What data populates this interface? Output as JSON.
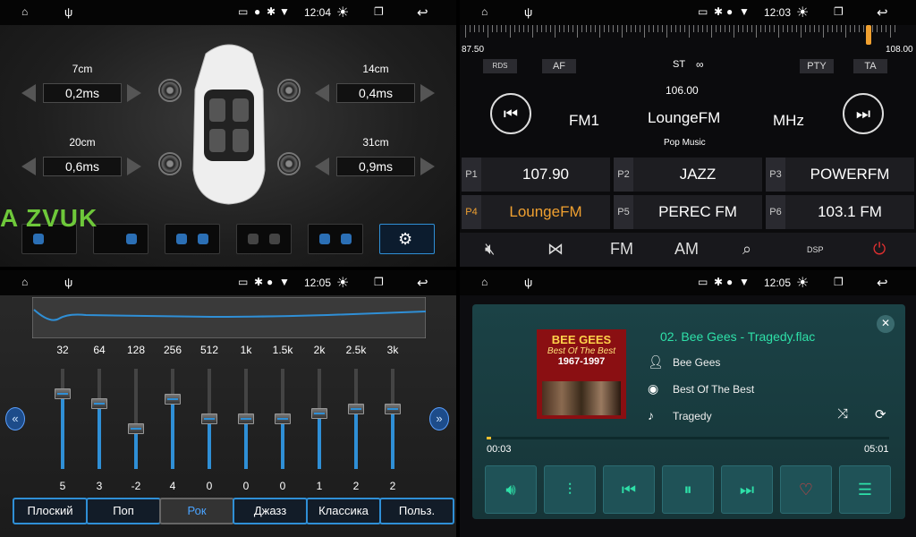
{
  "status": {
    "time_q1": "12:04",
    "time_q2": "12:03",
    "time_q3": "12:05",
    "time_q4": "12:05"
  },
  "watermark": "A ZVUK",
  "delay": {
    "fl": {
      "label": "7cm",
      "value": "0,2ms"
    },
    "fr": {
      "label": "14cm",
      "value": "0,4ms"
    },
    "rl": {
      "label": "20cm",
      "value": "0,6ms"
    },
    "rr": {
      "label": "31cm",
      "value": "0,9ms"
    }
  },
  "radio": {
    "scale_min": "87.50",
    "scale_max": "108.00",
    "rds": "RDS",
    "af": "AF",
    "st": "ST",
    "pty": "PTY",
    "ta": "TA",
    "frequency": "106.00",
    "band": "FM1",
    "station": "LoungeFM",
    "unit": "MHz",
    "genre": "Pop Music",
    "presets": [
      {
        "n": "P1",
        "v": "107.90"
      },
      {
        "n": "P2",
        "v": "JAZZ"
      },
      {
        "n": "P3",
        "v": "POWERFM"
      },
      {
        "n": "P4",
        "v": "LoungeFM"
      },
      {
        "n": "P5",
        "v": "PEREC FM"
      },
      {
        "n": "P6",
        "v": "103.1 FM"
      }
    ],
    "fm": "FM",
    "am": "AM",
    "dsp": "DSP"
  },
  "eq": {
    "bands": [
      "32",
      "64",
      "128",
      "256",
      "512",
      "1k",
      "1.5k",
      "2k",
      "2.5k",
      "3k"
    ],
    "values": [
      "5",
      "3",
      "-2",
      "4",
      "0",
      "0",
      "0",
      "1",
      "2",
      "2"
    ],
    "level_range": [
      -10,
      10
    ],
    "presets": [
      "Плоский",
      "Поп",
      "Рок",
      "Джазз",
      "Классика",
      "Польз."
    ],
    "active": "Рок"
  },
  "music": {
    "title": "02. Bee Gees - Tragedy.flac",
    "artist": "Bee Gees",
    "album": "Best Of The Best",
    "track": "Tragedy",
    "elapsed": "00:03",
    "total": "05:01",
    "cover_text1": "BEE GEES",
    "cover_text2": "Best Of The Best",
    "cover_text3": "1967-1997",
    "progress": 0.01
  }
}
